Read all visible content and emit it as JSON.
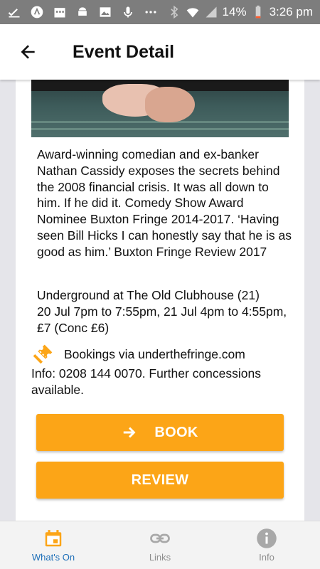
{
  "status_bar": {
    "battery": "14%",
    "time": "3:26 pm"
  },
  "app_bar": {
    "title": "Event Detail"
  },
  "event": {
    "description": "Award-winning comedian and ex-banker Nathan Cassidy exposes the secrets behind the 2008 financial crisis. It was all down to him. If he did it.  Comedy Show Award Nominee Buxton Fringe 2014-2017. ‘Having seen Bill Hicks I can honestly say that he is as good as him.’ Buxton Fringe Review 2017",
    "venue_line": "Underground at The Old Clubhouse (21)",
    "dates_line": "20 Jul 7pm to 7:55pm, 21 Jul 4pm to 4:55pm, £7 (Conc £6)",
    "booking": "Bookings via underthefringe.com",
    "info": "Info: 0208 144 0070. Further concessions available."
  },
  "buttons": {
    "book": "BOOK",
    "review": "REVIEW"
  },
  "bottom_nav": {
    "items": [
      {
        "label": "What's On",
        "icon": "calendar-icon",
        "active": true
      },
      {
        "label": "Links",
        "icon": "link-icon",
        "active": false
      },
      {
        "label": "Info",
        "icon": "info-icon",
        "active": false
      }
    ]
  },
  "colors": {
    "accent": "#fca517",
    "active_nav": "#1e6fb8",
    "status_bar": "#7d7d7d"
  }
}
